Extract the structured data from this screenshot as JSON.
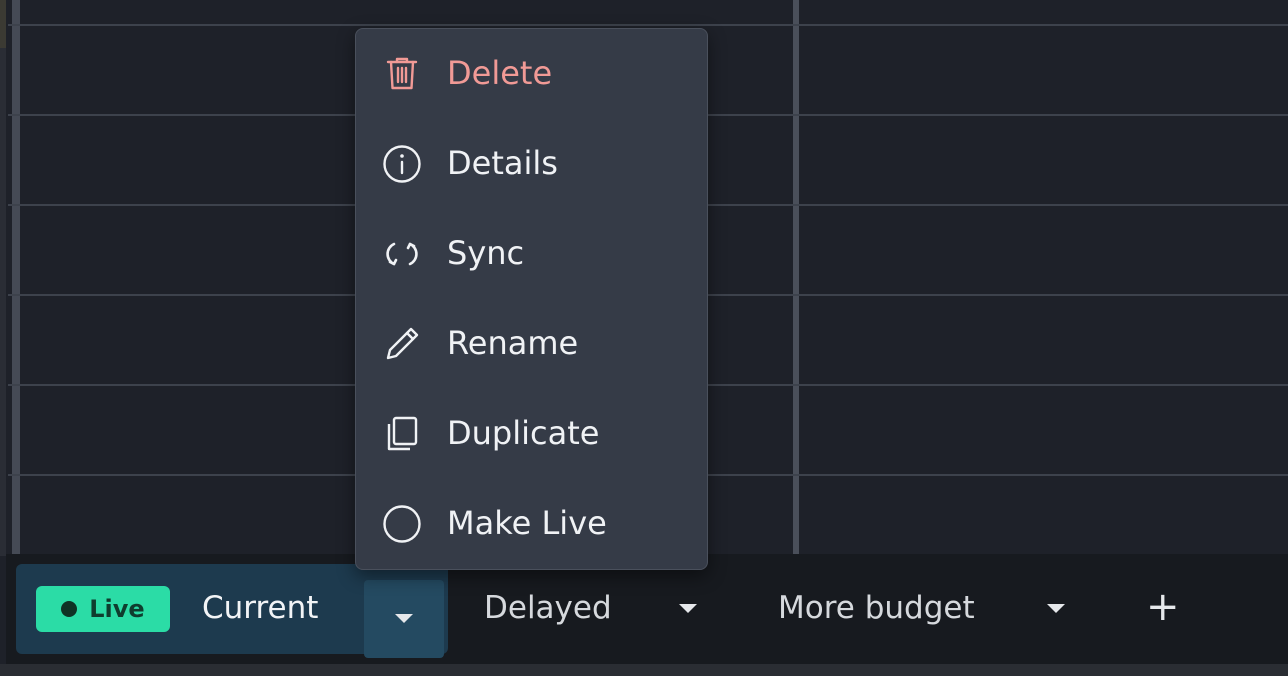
{
  "menu": {
    "items": [
      {
        "label": "Delete",
        "icon": "trash-icon",
        "color": "#f19a96"
      },
      {
        "label": "Details",
        "icon": "info-icon"
      },
      {
        "label": "Sync",
        "icon": "sync-icon"
      },
      {
        "label": "Rename",
        "icon": "pencil-icon"
      },
      {
        "label": "Duplicate",
        "icon": "copy-icon"
      },
      {
        "label": "Make Live",
        "icon": "circle-icon"
      }
    ]
  },
  "tabs": {
    "live_badge": "Live",
    "items": [
      {
        "label": "Current",
        "active": true
      },
      {
        "label": "Delayed",
        "active": false
      },
      {
        "label": "More budget",
        "active": false
      }
    ],
    "add_icon": "plus-icon"
  },
  "colors": {
    "background": "#1e2129",
    "menu_bg": "#353b47",
    "live_badge": "#2bdca6",
    "active_tab": "#1d3a4e",
    "danger": "#f19a96"
  }
}
